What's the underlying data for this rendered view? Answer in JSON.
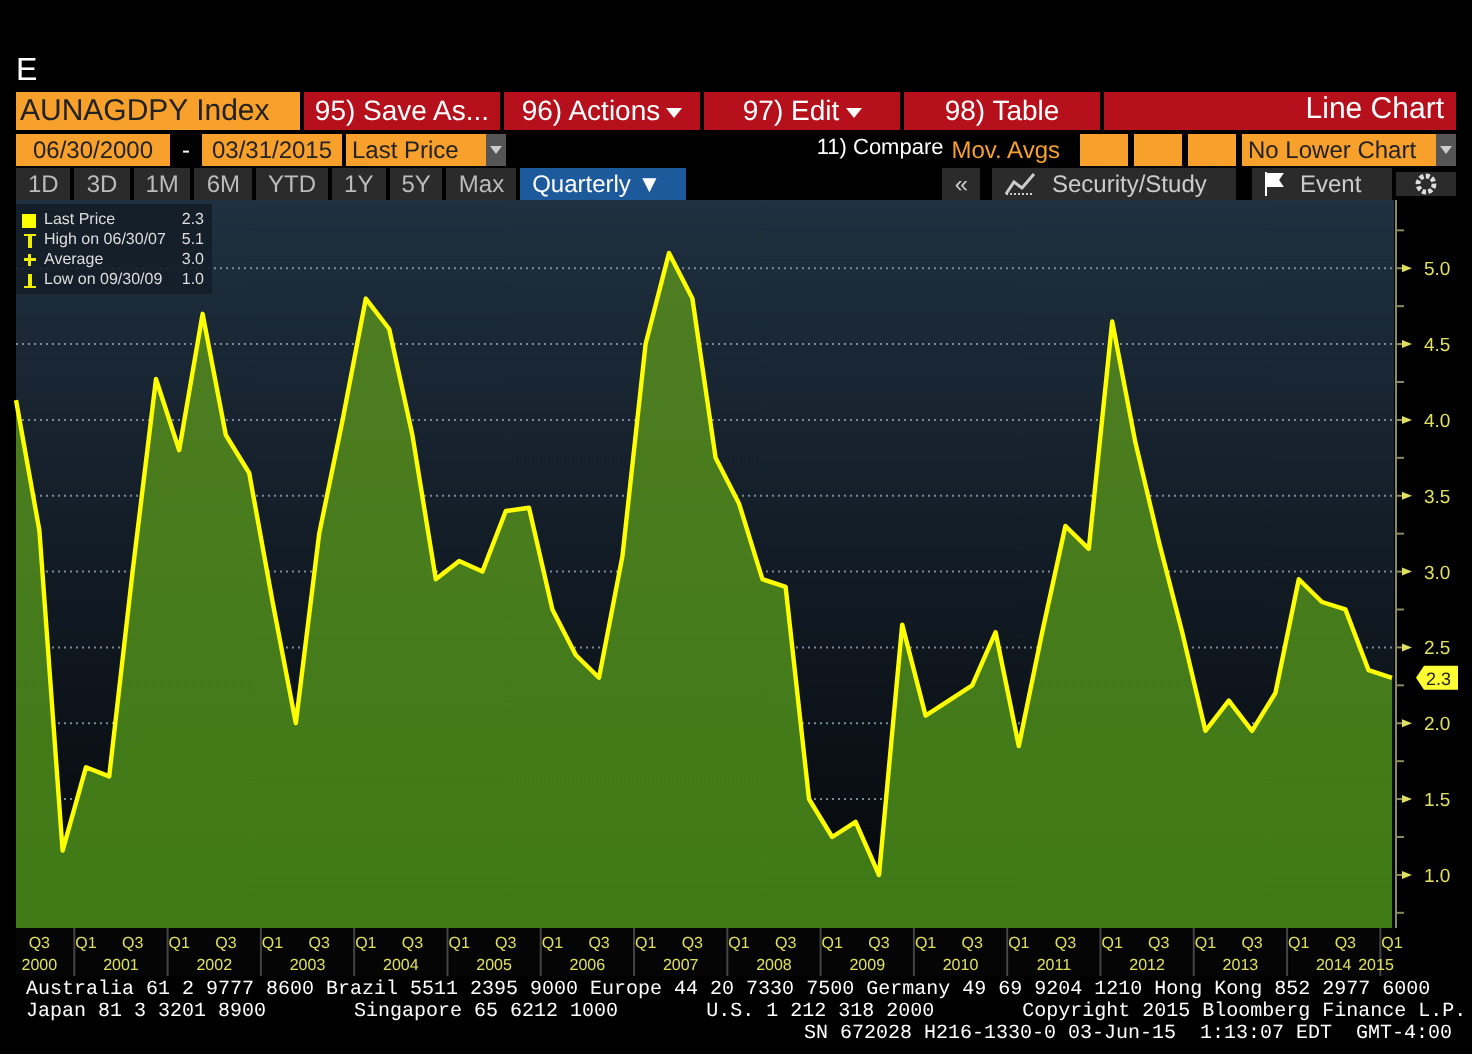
{
  "window": {
    "title": "E"
  },
  "toolbar": {
    "ticker": "AUNAGDPY Index",
    "buttons": [
      {
        "label": "95) Save As...",
        "dropdown": false
      },
      {
        "label": "96) Actions",
        "dropdown": true
      },
      {
        "label": "97) Edit",
        "dropdown": true
      },
      {
        "label": "98) Table",
        "dropdown": false
      }
    ],
    "chart_type": "Line Chart"
  },
  "range": {
    "start_date": "06/30/2000",
    "separator": "-",
    "end_date": "03/31/2015",
    "field": "Last Price",
    "compare_label": "11) Compare",
    "compare_value": "Mov. Avgs",
    "lower_chart": "No Lower Chart"
  },
  "periods": [
    {
      "label": "1D",
      "selected": false
    },
    {
      "label": "3D",
      "selected": false
    },
    {
      "label": "1M",
      "selected": false
    },
    {
      "label": "6M",
      "selected": false
    },
    {
      "label": "YTD",
      "selected": false
    },
    {
      "label": "1Y",
      "selected": false
    },
    {
      "label": "5Y",
      "selected": false
    },
    {
      "label": "Max",
      "selected": false
    },
    {
      "label": "Quarterly ▼",
      "selected": true
    }
  ],
  "tools": {
    "collapse": "«",
    "items": [
      {
        "kind": "study",
        "label": "Security/Study"
      },
      {
        "kind": "event",
        "label": "Event"
      },
      {
        "kind": "settings"
      }
    ]
  },
  "legend": [
    {
      "kind": "last",
      "value": "2.3"
    },
    {
      "kind": "high",
      "label": "High on 06/30/07",
      "value": "5.1"
    },
    {
      "kind": "average",
      "label": "Average",
      "value": "3.0"
    },
    {
      "kind": "low",
      "label": "Low on 09/30/09",
      "value": "1.0"
    }
  ],
  "chart": {
    "last_value_tag": "2.3",
    "year_labels": [
      "2000",
      "2001",
      "2002",
      "2003",
      "2004",
      "2005",
      "2006",
      "2007",
      "2008",
      "2009",
      "2010",
      "2011",
      "2012",
      "2013",
      "2014",
      "2015"
    ],
    "chart_data": {
      "type": "area",
      "grid": true,
      "ylim": [
        0.65,
        5.45
      ],
      "categories": [
        null,
        "Q3",
        null,
        "Q1",
        null,
        "Q3",
        null,
        "Q1",
        null,
        "Q3",
        null,
        "Q1",
        null,
        "Q3",
        null,
        "Q1",
        null,
        "Q3",
        null,
        "Q1",
        null,
        "Q3",
        null,
        "Q1",
        null,
        "Q3",
        null,
        "Q1",
        null,
        "Q3",
        null,
        "Q1",
        null,
        "Q3",
        null,
        "Q1",
        null,
        "Q3",
        null,
        "Q1",
        null,
        "Q3",
        null,
        "Q1",
        null,
        "Q3",
        null,
        "Q1",
        null,
        "Q3",
        null,
        "Q1",
        null,
        "Q3",
        null,
        "Q1",
        null,
        "Q3",
        null,
        "Q1"
      ],
      "series": [
        {
          "name": "Last Price",
          "color": "#ffff00",
          "values": [
            4.13,
            3.27,
            1.16,
            1.71,
            1.65,
            3.0,
            4.27,
            3.8,
            4.7,
            3.9,
            3.65,
            2.8,
            2.0,
            3.25,
            4.0,
            4.8,
            4.6,
            3.9,
            2.95,
            3.07,
            3.0,
            3.4,
            3.42,
            2.75,
            2.45,
            2.3,
            3.1,
            4.5,
            5.1,
            4.8,
            3.75,
            3.45,
            2.95,
            2.9,
            1.5,
            1.25,
            1.35,
            1.0,
            2.65,
            2.05,
            2.15,
            2.25,
            2.6,
            1.85,
            2.6,
            3.3,
            3.15,
            4.65,
            3.85,
            3.2,
            2.6,
            1.95,
            2.15,
            1.95,
            2.2,
            2.95,
            2.8,
            2.75,
            2.35,
            2.3
          ]
        }
      ],
      "yticks": [
        {
          "value": 1,
          "label": "1.0"
        },
        {
          "value": 1.5,
          "label": "1.5"
        },
        {
          "value": 2,
          "label": "2.0"
        },
        {
          "value": 2.5,
          "label": "2.5"
        },
        {
          "value": 3,
          "label": "3.0"
        },
        {
          "value": 3.5,
          "label": "3.5"
        },
        {
          "value": 4,
          "label": "4.0"
        },
        {
          "value": 4.5,
          "label": "4.5"
        },
        {
          "value": 5,
          "label": "5.0"
        }
      ]
    }
  },
  "footer": {
    "line_1": "Australia 61 2 9777 8600 Brazil 5511 2395 9000 Europe 44 20 7330 7500 Germany 49 69 9204 1210 Hong Kong 852 2977 6000",
    "line_2": [
      "Japan 81 3 3201 8900",
      "Singapore 65 6212 1000",
      "U.S. 1 212 318 2000",
      "Copyright 2015 Bloomberg Finance L.P."
    ],
    "line_3": "SN 672028 H216-1330-0 03-Jun-15  1:13:07 EDT  GMT-4:00"
  }
}
